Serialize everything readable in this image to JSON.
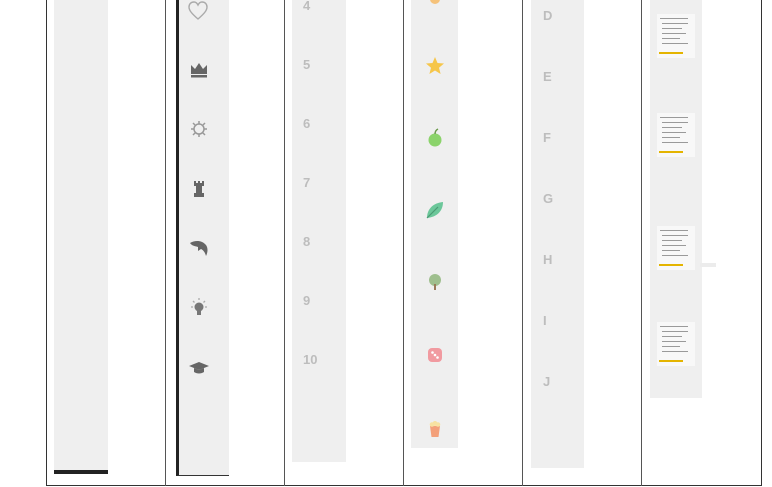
{
  "numbers": [
    "4",
    "5",
    "6",
    "7",
    "8",
    "9",
    "10"
  ],
  "letters": [
    "D",
    "E",
    "F",
    "G",
    "H",
    "I",
    "J"
  ],
  "icons_col2": [
    "heart-outline-icon",
    "crown-icon",
    "gear-bug-icon",
    "chess-rook-icon",
    "dolphin-icon",
    "lightbulb-icon",
    "graduation-cap-icon"
  ],
  "icons_col4": [
    "orange-partial-icon",
    "star-icon",
    "apple-icon",
    "leaf-icon",
    "tree-icon",
    "dice-icon",
    "popcorn-icon"
  ],
  "thumbnails": [
    "thumbnail-1",
    "thumbnail-2",
    "thumbnail-3",
    "thumbnail-4"
  ]
}
